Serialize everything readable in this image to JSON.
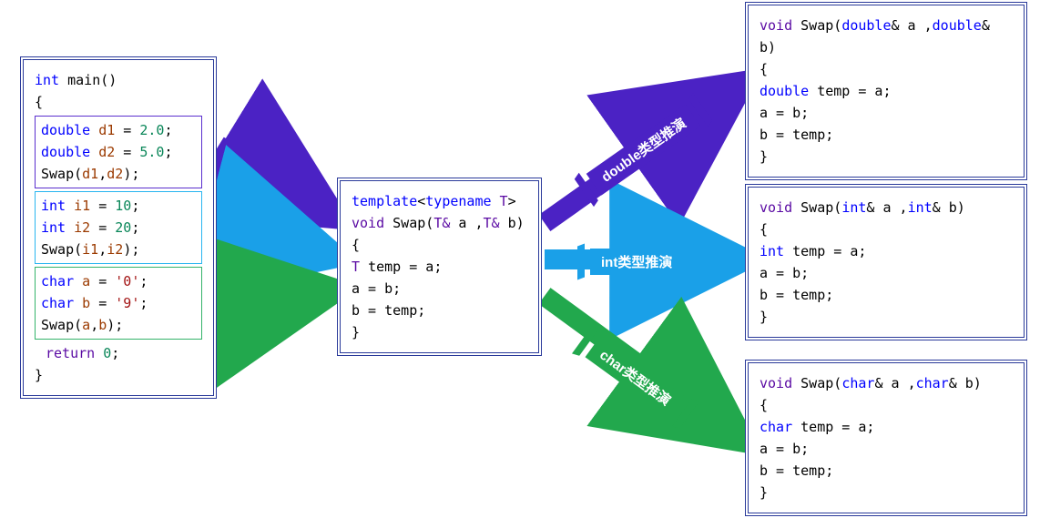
{
  "colors": {
    "purple": "#4b22c4",
    "cyan": "#1aa0e8",
    "green": "#22a84d",
    "boxBorder": "#2a3a9a"
  },
  "labels": {
    "double": "double类型推演",
    "int": "int类型推演",
    "char": "char类型推演"
  },
  "main": {
    "sig_kw": "int",
    "sig_name": " main()",
    "open": "{",
    "close": "}",
    "double_block": {
      "l1_kw": "double",
      "l1_var": " d1",
      "l1_eq": " = ",
      "l1_val": "2.0",
      "l1_end": ";",
      "l2_kw": "double",
      "l2_var": " d2",
      "l2_eq": " = ",
      "l2_val": "5.0",
      "l2_end": ";",
      "l3_call": "Swap(",
      "l3_a": "d1",
      "l3_sep": ",",
      "l3_b": "d2",
      "l3_end": ");"
    },
    "int_block": {
      "l1_kw": "int",
      "l1_var": " i1",
      "l1_eq": " = ",
      "l1_val": "10",
      "l1_end": ";",
      "l2_kw": "int",
      "l2_var": " i2",
      "l2_eq": " = ",
      "l2_val": "20",
      "l2_end": ";",
      "l3_call": "Swap(",
      "l3_a": "i1",
      "l3_sep": ",",
      "l3_b": "i2",
      "l3_end": ");"
    },
    "char_block": {
      "l1_kw": "char",
      "l1_var": " a",
      "l1_eq": " = ",
      "l1_val": "'0'",
      "l1_end": ";",
      "l2_kw": "char",
      "l2_var": " b",
      "l2_eq": " = ",
      "l2_val": "'9'",
      "l2_end": ";",
      "l3_call": "Swap(",
      "l3_a": "a",
      "l3_sep": ",",
      "l3_b": "b",
      "l3_end": ");"
    },
    "ret_kw": "return",
    "ret_val": " 0",
    "ret_end": ";"
  },
  "template": {
    "l1_tmpl": "template",
    "l1_open": "<",
    "l1_typename": "typename",
    "l1_T": " T",
    "l1_close": ">",
    "l2_void": "void",
    "l2_name": " Swap(",
    "l2_tref1": "T& ",
    "l2_a": "a ",
    "l2_sep": ",",
    "l2_tref2": "T& ",
    "l2_b": "b",
    "l2_end": ")",
    "open": "{",
    "l3_indent": "    ",
    "l3_T": "T ",
    "l3_temp": "temp = ",
    "l3_a": "a",
    "l3_end": ";",
    "l4_indent": "    ",
    "l4_body": "a = b;",
    "l5_indent": "    ",
    "l5_body": "b = temp;",
    "close": "}"
  },
  "out_double": {
    "sig_void": "void",
    "sig_name": " Swap(",
    "sig_t1": "double",
    "sig_a": "& a ",
    "sig_sep": ",",
    "sig_t2": "double",
    "sig_b": "& b)",
    "open": "{",
    "l1_indent": "    ",
    "l1_kw": "double",
    "l1_rest": " temp = a;",
    "l2_indent": "    ",
    "l2": "a = b;",
    "l3_indent": "    ",
    "l3": "b = temp;",
    "close": "}"
  },
  "out_int": {
    "sig_void": "void",
    "sig_name": " Swap(",
    "sig_t1": "int",
    "sig_a": "& a ",
    "sig_sep": ",",
    "sig_t2": "int",
    "sig_b": "& b)",
    "open": "{",
    "l1_indent": "    ",
    "l1_kw": "int",
    "l1_rest": " temp = a;",
    "l2_indent": "    ",
    "l2": "a = b;",
    "l3_indent": "    ",
    "l3": "b = temp;",
    "close": "}"
  },
  "out_char": {
    "sig_void": "void",
    "sig_name": " Swap(",
    "sig_t1": "char",
    "sig_a": "& a ",
    "sig_sep": ",",
    "sig_t2": "char",
    "sig_b": "& b)",
    "open": "{",
    "l1_indent": "    ",
    "l1_kw": "char",
    "l1_rest": " temp = a;",
    "l2_indent": "    ",
    "l2": "a = b;",
    "l3_indent": "    ",
    "l3": "b = temp;",
    "close": "}"
  }
}
